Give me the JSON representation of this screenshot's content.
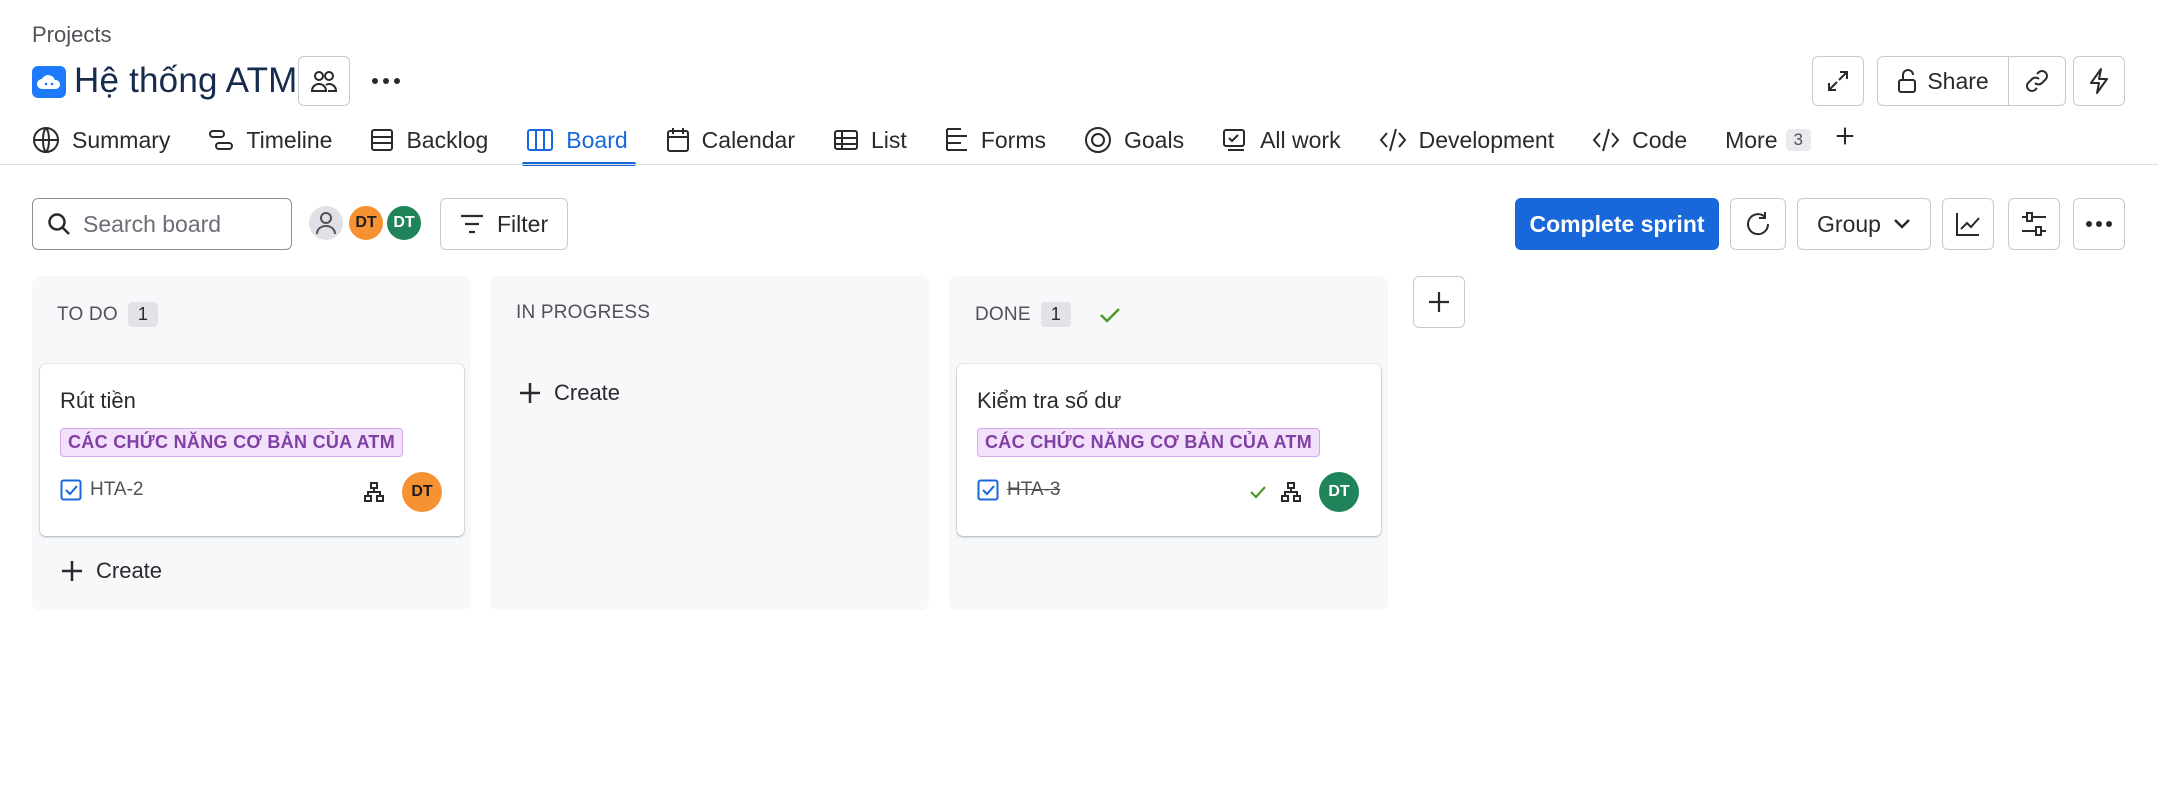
{
  "breadcrumb": "Projects",
  "project": {
    "title": "Hệ thống ATM",
    "icon": "cloud-icon",
    "accent": "#1d7afc"
  },
  "header_actions": {
    "share_label": "Share"
  },
  "tabs": [
    {
      "label": "Summary",
      "icon": "globe-icon"
    },
    {
      "label": "Timeline",
      "icon": "timeline-icon"
    },
    {
      "label": "Backlog",
      "icon": "backlog-icon"
    },
    {
      "label": "Board",
      "icon": "board-icon",
      "active": true
    },
    {
      "label": "Calendar",
      "icon": "calendar-icon"
    },
    {
      "label": "List",
      "icon": "list-icon"
    },
    {
      "label": "Forms",
      "icon": "forms-icon"
    },
    {
      "label": "Goals",
      "icon": "goals-icon"
    },
    {
      "label": "All work",
      "icon": "all-work-icon"
    },
    {
      "label": "Development",
      "icon": "development-icon"
    },
    {
      "label": "Code",
      "icon": "code-icon"
    },
    {
      "label": "More",
      "count": "3"
    }
  ],
  "toolbar": {
    "search_placeholder": "Search board",
    "avatars": [
      "DT",
      "DT"
    ],
    "filter_label": "Filter",
    "complete_sprint_label": "Complete sprint",
    "group_label": "Group",
    "primary_color": "#1868db"
  },
  "columns": [
    {
      "name": "TO DO",
      "count": "1",
      "cards": [
        {
          "title": "Rút tiền",
          "label": "CÁC CHỨC NĂNG CƠ BẢN CỦA ATM",
          "key": "HTA-2",
          "assignee": "DT",
          "assignee_color": "#f79232"
        }
      ],
      "create_label": "Create"
    },
    {
      "name": "IN PROGRESS",
      "cards": [],
      "create_label": "Create"
    },
    {
      "name": "DONE",
      "count": "1",
      "cards": [
        {
          "title": "Kiểm tra số dư",
          "label": "CÁC CHỨC NĂNG CƠ BẢN CỦA ATM",
          "key": "HTA-3",
          "assignee": "DT",
          "assignee_color": "#1f845a"
        }
      ]
    }
  ]
}
